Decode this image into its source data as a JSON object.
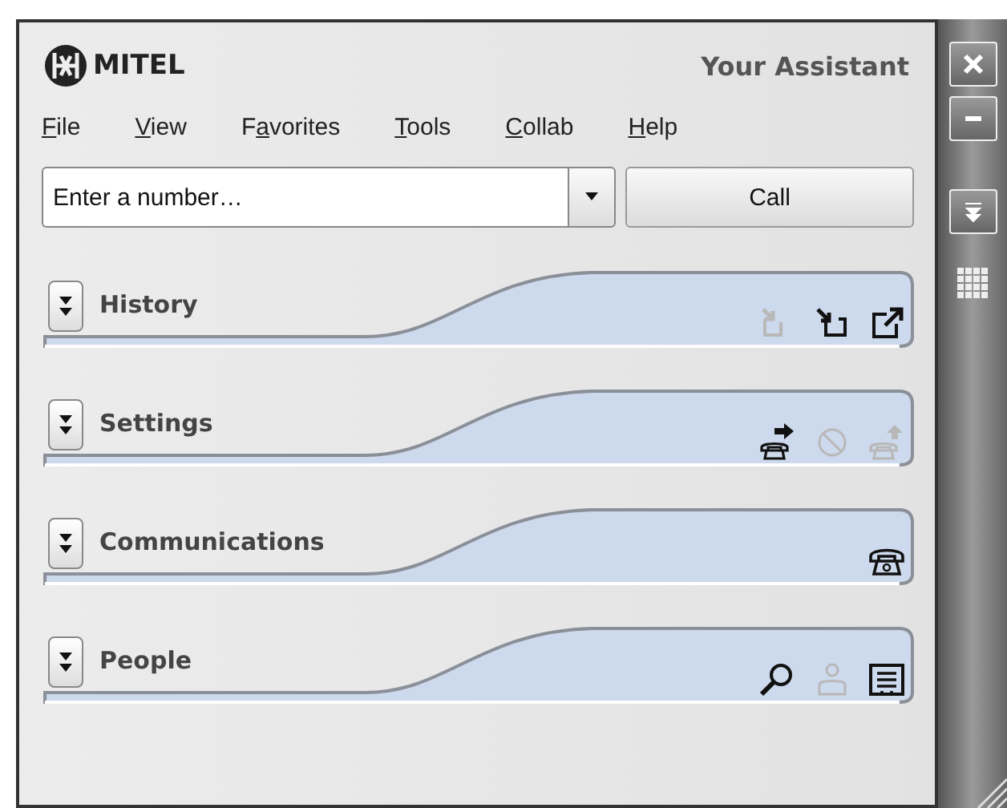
{
  "header": {
    "brand": "MITEL",
    "title": "Your Assistant"
  },
  "menu": [
    {
      "key": "F",
      "rest": "ile"
    },
    {
      "key": "V",
      "rest": "iew"
    },
    {
      "pre": "F",
      "key": "a",
      "rest": "vorites"
    },
    {
      "key": "T",
      "rest": "ools"
    },
    {
      "key": "C",
      "rest": "ollab"
    },
    {
      "key": "H",
      "rest": "elp"
    }
  ],
  "dial": {
    "placeholder": "Enter a number…",
    "button": "Call"
  },
  "sections": [
    {
      "title": "History",
      "icons": [
        {
          "kind": "history-in",
          "disabled": true
        },
        {
          "kind": "history-back",
          "disabled": false
        },
        {
          "kind": "history-out",
          "disabled": false
        }
      ]
    },
    {
      "title": "Settings",
      "icons": [
        {
          "kind": "forward",
          "disabled": false
        },
        {
          "kind": "dnd",
          "disabled": true
        },
        {
          "kind": "phone-up",
          "disabled": true
        }
      ]
    },
    {
      "title": "Communications",
      "icons": [
        {
          "kind": "phone",
          "disabled": false
        }
      ]
    },
    {
      "title": "People",
      "icons": [
        {
          "kind": "search",
          "disabled": false
        },
        {
          "kind": "person",
          "disabled": true
        },
        {
          "kind": "directory",
          "disabled": false
        }
      ]
    }
  ]
}
